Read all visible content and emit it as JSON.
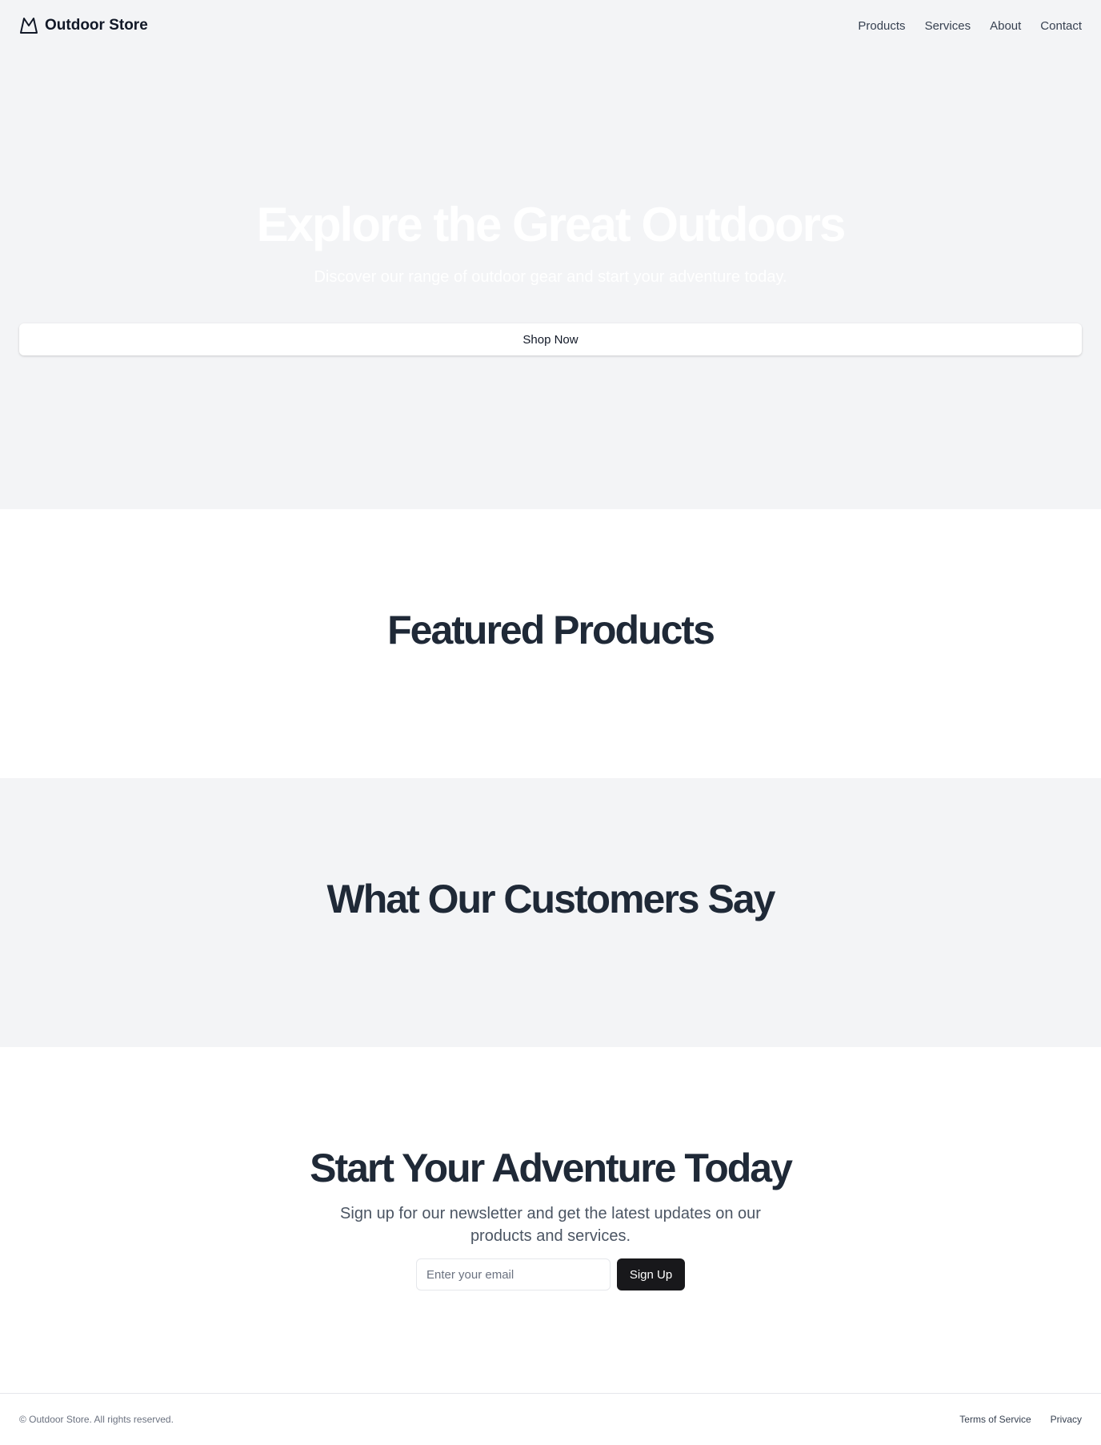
{
  "header": {
    "brand_name": "Outdoor Store",
    "brand_icon": "mountain-icon",
    "nav": [
      "Products",
      "Services",
      "About",
      "Contact"
    ]
  },
  "hero": {
    "title": "Explore the Great Outdoors",
    "subtitle": "Discover our range of outdoor gear and start your adventure today.",
    "cta_label": "Shop Now"
  },
  "featured": {
    "title": "Featured Products"
  },
  "testimonials": {
    "title": "What Our Customers Say"
  },
  "cta": {
    "title": "Start Your Adventure Today",
    "subtitle": "Sign up for our newsletter and get the latest updates on our products and services.",
    "email_placeholder": "Enter your email",
    "signup_label": "Sign Up"
  },
  "footer": {
    "copyright": "© Outdoor Store. All rights reserved.",
    "links": [
      "Terms of Service",
      "Privacy"
    ]
  },
  "colors": {
    "hero_bg": "#f3f4f6",
    "heading": "#1f2937",
    "button_dark": "#18181b"
  }
}
